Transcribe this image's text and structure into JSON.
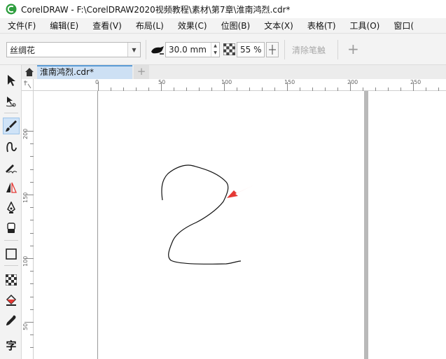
{
  "window": {
    "title": "CorelDRAW - F:\\CorelDRAW2020视频教程\\素材\\第7章\\淮南鸿烈.cdr*"
  },
  "menu": [
    {
      "label": "文件(F)"
    },
    {
      "label": "编辑(E)"
    },
    {
      "label": "查看(V)"
    },
    {
      "label": "布局(L)"
    },
    {
      "label": "效果(C)"
    },
    {
      "label": "位图(B)"
    },
    {
      "label": "文本(X)"
    },
    {
      "label": "表格(T)"
    },
    {
      "label": "工具(O)"
    },
    {
      "label": "窗口("
    }
  ],
  "propbar": {
    "preset": "丝绸花",
    "stroke_width": "30.0 mm",
    "transparency": "55 %",
    "clear_label": "清除笔触",
    "add_label": "+"
  },
  "document_tab": {
    "label": "淮南鸿烈.cdr*",
    "new_tab": "+"
  },
  "ruler": {
    "h_labels": [
      "0",
      "50",
      "100",
      "150",
      "200",
      "250"
    ],
    "v_labels": [
      "200",
      "150",
      "100",
      "50"
    ],
    "corner_label": "px"
  },
  "toolbox": {
    "tools": [
      "pick-tool",
      "shape-tool",
      "artistic-media-tool",
      "freehand-tool",
      "smear-tool",
      "mirror-tool",
      "pen-tool",
      "eraser-tool",
      "rectangle-tool",
      "transparency-tool",
      "fill-tool",
      "eyedropper-tool",
      "text-tool"
    ],
    "text_tool_glyph": "字"
  },
  "colors": {
    "accent": "#5b9bd5",
    "active_tab": "#cde0f4",
    "arrow": "#e53935"
  }
}
